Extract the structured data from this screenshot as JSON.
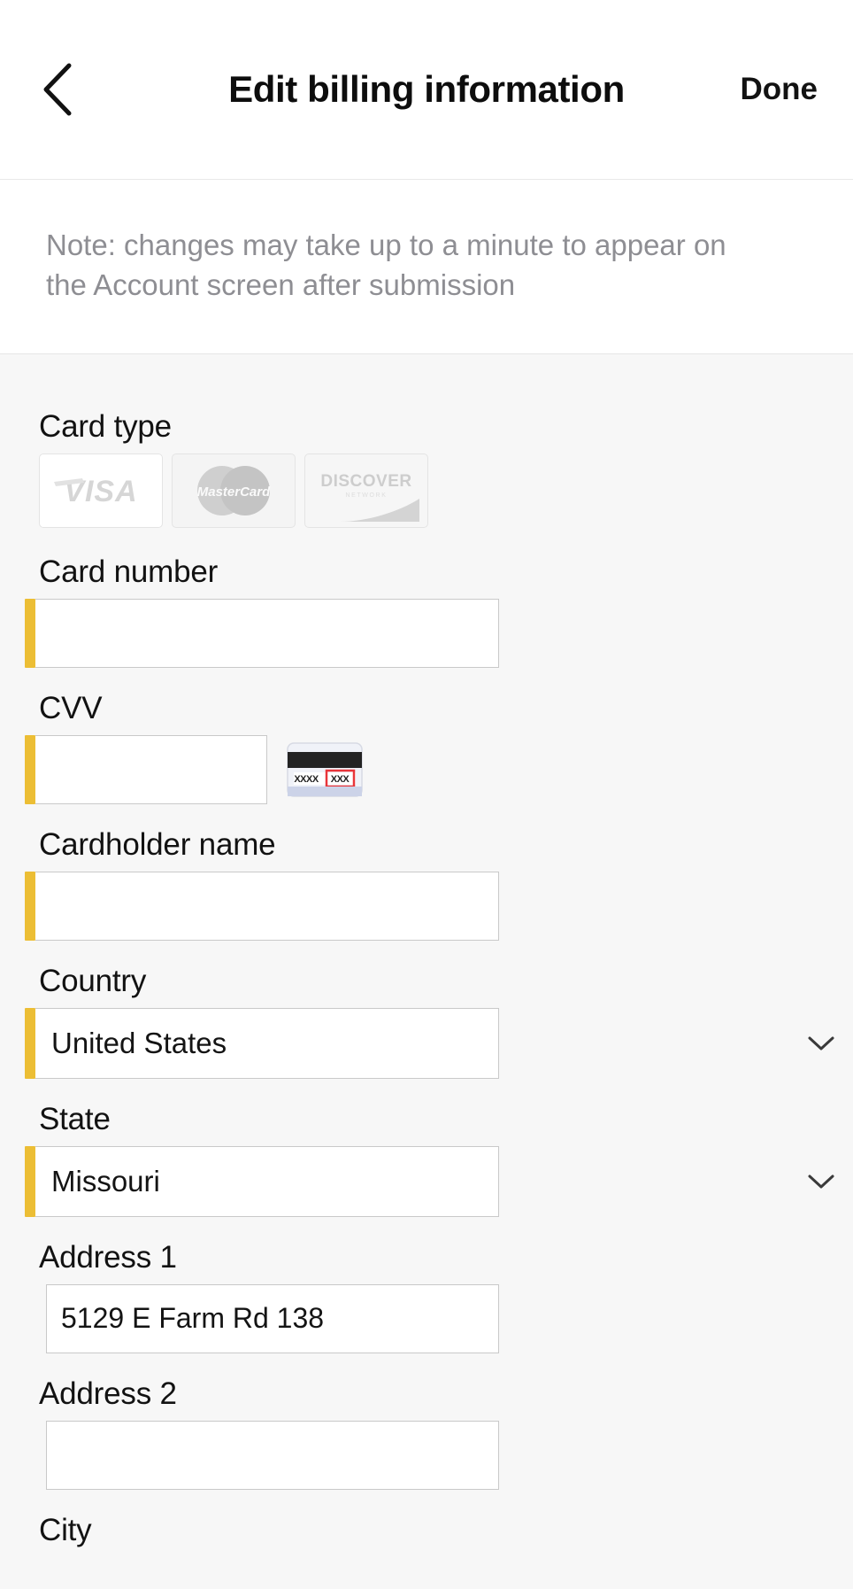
{
  "header": {
    "back_icon": "chevron-left-icon",
    "title": "Edit billing information",
    "done_label": "Done"
  },
  "note": {
    "text": "Note: changes may take up to a minute to appear on the Account screen after submission"
  },
  "form": {
    "card_type": {
      "label": "Card type",
      "options": [
        {
          "name": "VISA",
          "icon": "visa-logo-icon",
          "selected": false
        },
        {
          "name": "MasterCard",
          "icon": "mastercard-logo-icon",
          "selected": false
        },
        {
          "name": "DISCOVER",
          "icon": "discover-logo-icon",
          "selected": false
        }
      ]
    },
    "card_number": {
      "label": "Card number",
      "value": "",
      "placeholder": "",
      "required_indicator": true
    },
    "cvv": {
      "label": "CVV",
      "value": "",
      "placeholder": "",
      "required_indicator": true,
      "helper_icon": "cvv-card-back-icon"
    },
    "cardholder_name": {
      "label": "Cardholder name",
      "value": "",
      "placeholder": "",
      "required_indicator": true
    },
    "country": {
      "label": "Country",
      "value": "United States",
      "required_indicator": true,
      "chevron": "chevron-down-icon"
    },
    "state": {
      "label": "State",
      "value": "Missouri",
      "required_indicator": true,
      "chevron": "chevron-down-icon"
    },
    "address1": {
      "label": "Address 1",
      "value": "5129 E Farm Rd 138",
      "placeholder": "",
      "required_indicator": false
    },
    "address2": {
      "label": "Address 2",
      "value": "",
      "placeholder": "",
      "required_indicator": false
    },
    "city": {
      "label": "City"
    }
  },
  "colors": {
    "accent_validation": "#ecbe35",
    "page_background": "#f7f7f7",
    "surface": "#ffffff",
    "text_primary": "#121212",
    "text_muted": "#8e8e93",
    "border": "#c9c9c9"
  }
}
